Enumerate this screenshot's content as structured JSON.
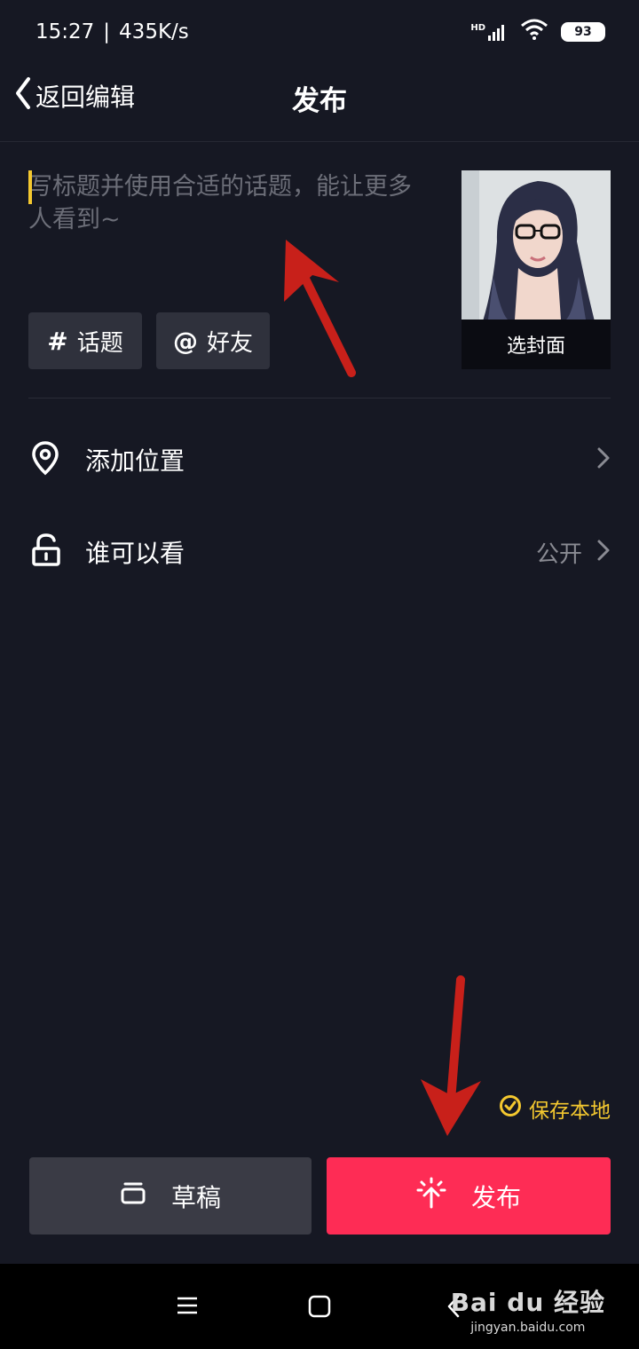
{
  "status": {
    "time": "15:27",
    "separator": "|",
    "speed": "435K/s",
    "battery": "93",
    "hd": "HD"
  },
  "header": {
    "back_label": "返回编辑",
    "title": "发布"
  },
  "caption": {
    "placeholder": "写标题并使用合适的话题，能让更多人看到~"
  },
  "chips": {
    "topic_symbol": "#",
    "topic_label": "话题",
    "friend_symbol": "@",
    "friend_label": "好友"
  },
  "cover": {
    "label": "选封面"
  },
  "settings": {
    "location_label": "添加位置",
    "visibility_label": "谁可以看",
    "visibility_value": "公开"
  },
  "save_local": {
    "label": "保存本地",
    "checked": true
  },
  "actions": {
    "draft_label": "草稿",
    "publish_label": "发布"
  },
  "watermark": {
    "brand": "Bai du 经验",
    "site": "jingyan.baidu.com"
  },
  "colors": {
    "background": "#161823",
    "accent_red": "#fe2c55",
    "accent_yellow": "#f4c82f",
    "chip_bg": "#2f313c",
    "annotation_arrow": "#c8201a"
  }
}
